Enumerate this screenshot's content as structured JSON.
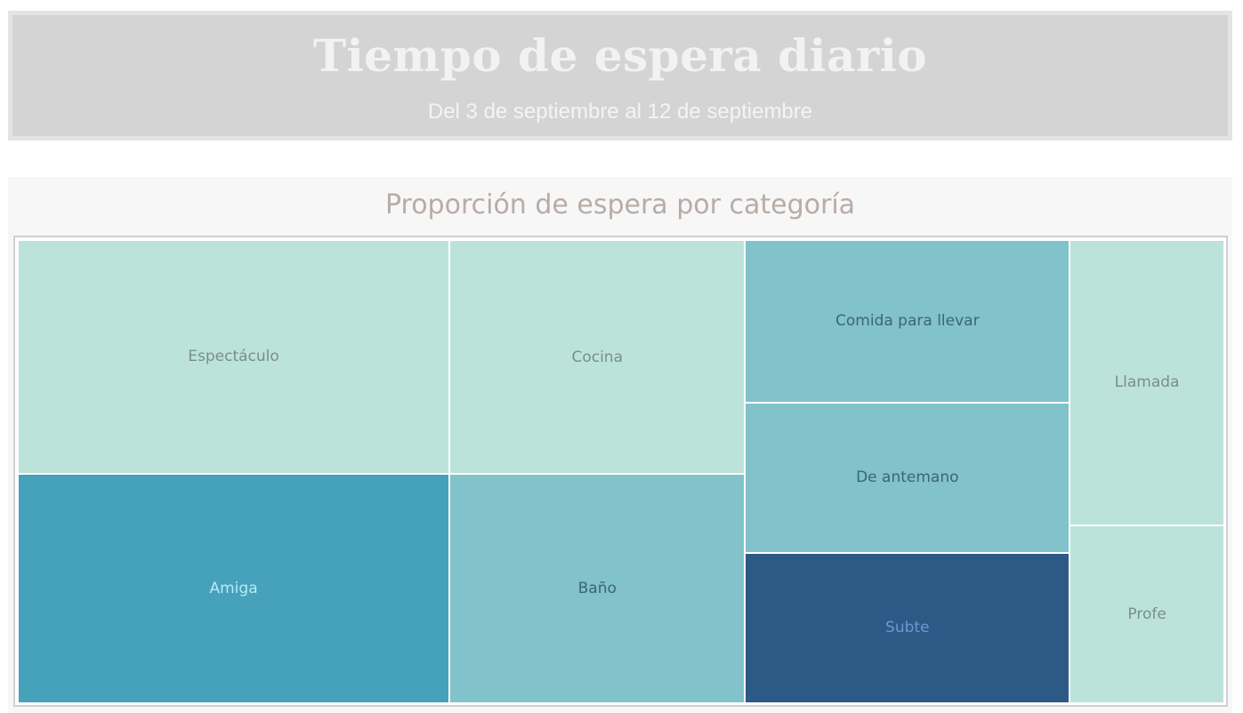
{
  "header": {
    "title": "Tiempo de espera diario",
    "subtitle": "Del 3 de septiembre al 12 de septiembre"
  },
  "chart_data": {
    "type": "treemap",
    "title": "Proporción de espera por categoría",
    "items": [
      {
        "name": "Espectáculo",
        "value": 128,
        "color": "#bce3d9",
        "label_color": "#7a8f86"
      },
      {
        "name": "Amiga",
        "value": 126,
        "color": "#46a1bb",
        "label_color": "#b8ecf3"
      },
      {
        "name": "Cocina",
        "value": 88,
        "color": "#bce3d9",
        "label_color": "#7a8f86"
      },
      {
        "name": "Baño",
        "value": 86,
        "color": "#81c2cb",
        "label_color": "#3d6670"
      },
      {
        "name": "Comida para llevar",
        "value": 67,
        "color": "#81c2cb",
        "label_color": "#3d6670"
      },
      {
        "name": "De antemano",
        "value": 62,
        "color": "#81c2cb",
        "label_color": "#3d6670"
      },
      {
        "name": "Subte",
        "value": 62,
        "color": "#2d5986",
        "label_color": "#6b98d3"
      },
      {
        "name": "Llamada",
        "value": 56,
        "color": "#bce3d9",
        "label_color": "#7a8f86"
      },
      {
        "name": "Profe",
        "value": 35,
        "color": "#bce3d9",
        "label_color": "#7a8f86"
      }
    ]
  }
}
